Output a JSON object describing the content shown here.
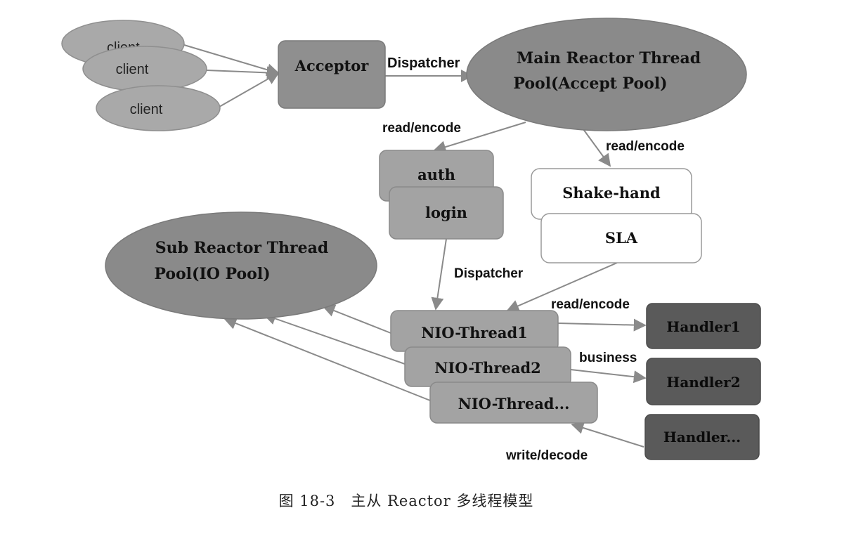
{
  "diagram": {
    "clients": [
      "client",
      "client",
      "client"
    ],
    "acceptor": "Acceptor",
    "main_reactor": [
      "Main Reactor Thread",
      "Pool(Accept Pool)"
    ],
    "sub_reactor": [
      "Sub Reactor Thread",
      "Pool(IO Pool)"
    ],
    "auth": "auth",
    "login": "login",
    "shake_hand": "Shake-hand",
    "sla": "SLA",
    "nio_threads": [
      "NIO-Thread1",
      "NIO-Thread2",
      "NIO-Thread..."
    ],
    "handlers": [
      "Handler1",
      "Handler2",
      "Handler..."
    ],
    "edge_labels": {
      "dispatcher_top": "Dispatcher",
      "read_encode_left": "read/encode",
      "read_encode_right": "read/encode",
      "dispatcher_mid": "Dispatcher",
      "read_encode_nio": "read/encode",
      "business": "business",
      "write_decode": "write/decode"
    },
    "caption": "图 18-3　主从 Reactor 多线程模型"
  },
  "colors": {
    "client_fill": "#a9a9a9",
    "box_fill": "#8f8f8f",
    "ellipse_fill": "#8a8a8a",
    "auth_fill": "#a3a3a3",
    "white_box_fill": "#ffffff",
    "handler_fill": "#5a5a5a",
    "edge": "#8a8a8a",
    "text": "#111111"
  }
}
